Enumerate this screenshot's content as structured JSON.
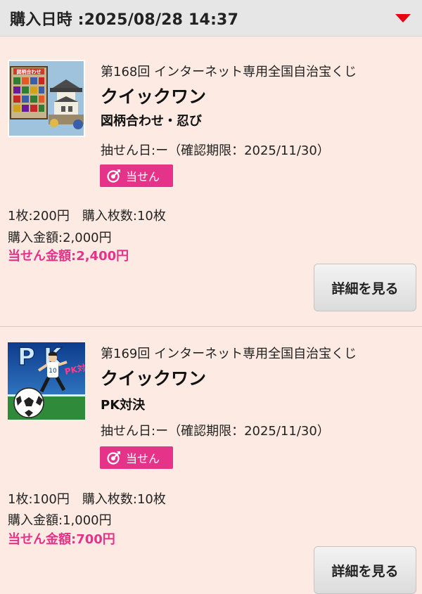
{
  "header": {
    "title": "購入日時 :2025/08/28 14:37",
    "dropdown_icon": "caret-down-icon",
    "accent_color": "#e60012"
  },
  "colors": {
    "background": "#fdebe3",
    "badge": "#e6338a",
    "win_amount": "#e6338a"
  },
  "items": [
    {
      "thumbnail": "zugara-awase-ninja-thumbnail",
      "thumbnail_text": "図柄合わせ",
      "lottery_name": "第168回 インターネット専用全国自治宝くじ",
      "game_name": "クイックワン",
      "sub_name": "図柄合わせ・忍び",
      "draw_date": "抽せん日:ー（確認期限：2025/11/30）",
      "badge_label": "当せん",
      "badge_icon": "target-icon",
      "unit_price": "1枚:200円",
      "quantity": "購入枚数:10枚",
      "purchase_amount": "購入金額:2,000円",
      "win_amount": "当せん金額:2,400円",
      "detail_button": "詳細を見る"
    },
    {
      "thumbnail": "pk-taiketsu-thumbnail",
      "thumbnail_text": "PK対決",
      "thumbnail_letters": "P K",
      "thumbnail_jersey": "10",
      "lottery_name": "第169回 インターネット専用全国自治宝くじ",
      "game_name": "クイックワン",
      "sub_name": "PK対決",
      "draw_date": "抽せん日:ー（確認期限：2025/11/30）",
      "badge_label": "当せん",
      "badge_icon": "target-icon",
      "unit_price": "1枚:100円",
      "quantity": "購入枚数:10枚",
      "purchase_amount": "購入金額:1,000円",
      "win_amount": "当せん金額:700円",
      "detail_button": "詳細を見る"
    }
  ]
}
